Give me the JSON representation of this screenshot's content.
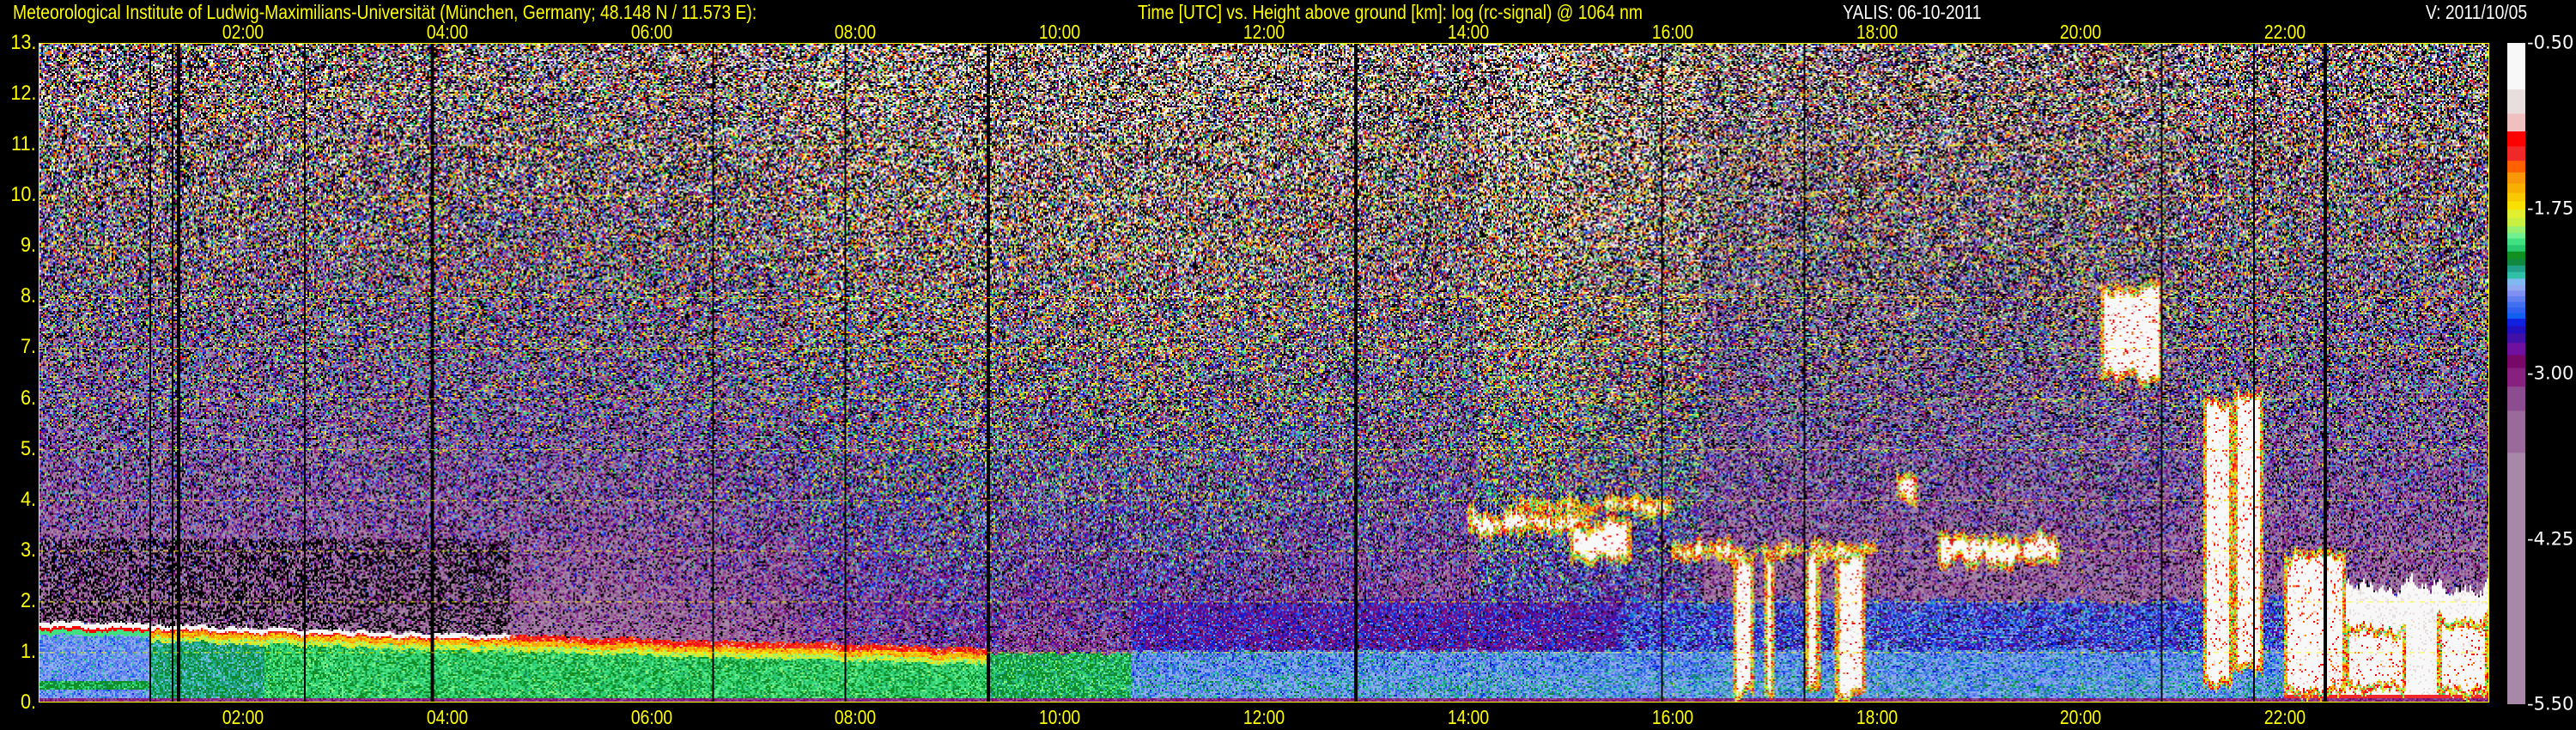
{
  "header": {
    "institute": "Meteorological Institute of Ludwig-Maximilians-Universität (München, Germany; 48.148 N / 11.573 E):",
    "description": "Time [UTC] vs. Height above ground [km]: log (rc-signal) @ 1064 nm",
    "instrument_date": "YALIS: 06-10-2011",
    "version": "V: 2011/10/05"
  },
  "chart_data": {
    "type": "heatmap",
    "title": "Time [UTC] vs. Height above ground [km]: log (rc-signal) @ 1064 nm",
    "xlabel": "Time [UTC]",
    "ylabel": "Height above ground [km]",
    "xlim_hours": [
      0,
      24
    ],
    "ylim_km": [
      0,
      13
    ],
    "x_ticks": [
      "02:00",
      "04:00",
      "06:00",
      "08:00",
      "10:00",
      "12:00",
      "14:00",
      "16:00",
      "18:00",
      "20:00",
      "22:00"
    ],
    "x_tick_hours": [
      2,
      4,
      6,
      8,
      10,
      12,
      14,
      16,
      18,
      20,
      22
    ],
    "y_ticks": [
      "0.",
      "1.",
      "2.",
      "3.",
      "4.",
      "5.",
      "6.",
      "7.",
      "8.",
      "9.",
      "10.",
      "11.",
      "12.",
      "13."
    ],
    "grid": true,
    "colorbar": {
      "range": [
        -5.5,
        -0.5
      ],
      "tick_labels": [
        "-0.50",
        "-1.75",
        "-3.00",
        "-4.25",
        "-5.50"
      ],
      "tick_values": [
        -0.5,
        -1.75,
        -3.0,
        -4.25,
        -5.5
      ],
      "bins": [
        {
          "from": -0.5,
          "to": -0.852,
          "color": "#f8f8f8"
        },
        {
          "from": -0.852,
          "to": -1.035,
          "color": "#e8dede"
        },
        {
          "from": -1.035,
          "to": -1.169,
          "color": "#f0c0c0"
        },
        {
          "from": -1.169,
          "to": -1.282,
          "color": "#ff0000"
        },
        {
          "from": -1.282,
          "to": -1.391,
          "color": "#f02828"
        },
        {
          "from": -1.391,
          "to": -1.479,
          "color": "#ff6000"
        },
        {
          "from": -1.479,
          "to": -1.563,
          "color": "#f89808"
        },
        {
          "from": -1.563,
          "to": -1.634,
          "color": "#f8b000"
        },
        {
          "from": -1.634,
          "to": -1.697,
          "color": "#f8c800"
        },
        {
          "from": -1.697,
          "to": -1.761,
          "color": "#f8e000"
        },
        {
          "from": -1.761,
          "to": -1.824,
          "color": "#e0f030"
        },
        {
          "from": -1.824,
          "to": -1.887,
          "color": "#c8f040"
        },
        {
          "from": -1.887,
          "to": -1.937,
          "color": "#98f070"
        },
        {
          "from": -1.937,
          "to": -1.979,
          "color": "#70f090"
        },
        {
          "from": -1.979,
          "to": -2.028,
          "color": "#40e080"
        },
        {
          "from": -2.028,
          "to": -2.077,
          "color": "#28c870"
        },
        {
          "from": -2.077,
          "to": -2.134,
          "color": "#109020"
        },
        {
          "from": -2.134,
          "to": -2.183,
          "color": "#108840"
        },
        {
          "from": -2.183,
          "to": -2.232,
          "color": "#20a088"
        },
        {
          "from": -2.232,
          "to": -2.282,
          "color": "#30c0a8"
        },
        {
          "from": -2.282,
          "to": -2.331,
          "color": "#80b8f0"
        },
        {
          "from": -2.331,
          "to": -2.373,
          "color": "#90a8f0"
        },
        {
          "from": -2.373,
          "to": -2.415,
          "color": "#8090f0"
        },
        {
          "from": -2.415,
          "to": -2.458,
          "color": "#6080f0"
        },
        {
          "from": -2.458,
          "to": -2.5,
          "color": "#4070f0"
        },
        {
          "from": -2.5,
          "to": -2.542,
          "color": "#3060f0"
        },
        {
          "from": -2.542,
          "to": -2.585,
          "color": "#1060f0"
        },
        {
          "from": -2.585,
          "to": -2.641,
          "color": "#1020e0"
        },
        {
          "from": -2.641,
          "to": -2.697,
          "color": "#2010c0"
        },
        {
          "from": -2.697,
          "to": -2.768,
          "color": "#4010a8"
        },
        {
          "from": -2.768,
          "to": -2.859,
          "color": "#7010a0"
        },
        {
          "from": -2.859,
          "to": -2.958,
          "color": "#780868"
        },
        {
          "from": -2.958,
          "to": -3.099,
          "color": "#882080"
        },
        {
          "from": -3.099,
          "to": -3.282,
          "color": "#8c4c90"
        },
        {
          "from": -3.282,
          "to": -3.599,
          "color": "#9a6a9a"
        },
        {
          "from": -3.599,
          "to": -5.5,
          "color": "#a888a8"
        }
      ]
    },
    "cloud_features_hours_km": [
      [
        14.0,
        15.2,
        3.3,
        3.75
      ],
      [
        14.5,
        16.0,
        3.7,
        4.0
      ],
      [
        15.0,
        15.6,
        2.7,
        3.6
      ],
      [
        16.0,
        16.6,
        2.8,
        3.2
      ],
      [
        16.5,
        18.0,
        2.8,
        3.1
      ],
      [
        16.6,
        16.8,
        0.1,
        3.0
      ],
      [
        16.9,
        17.0,
        0.1,
        3.0
      ],
      [
        17.3,
        17.45,
        0.1,
        3.0
      ],
      [
        17.6,
        17.9,
        0.05,
        3.0
      ],
      [
        18.2,
        18.4,
        4.0,
        4.5
      ],
      [
        18.6,
        19.8,
        2.7,
        3.3
      ],
      [
        20.2,
        20.8,
        6.3,
        8.3
      ],
      [
        21.2,
        21.5,
        0.3,
        6.0
      ],
      [
        21.5,
        21.8,
        0.6,
        6.2
      ],
      [
        22.0,
        22.6,
        0.1,
        3.0
      ],
      [
        22.6,
        23.2,
        0.2,
        1.5
      ],
      [
        23.5,
        24.0,
        0.1,
        1.7
      ]
    ],
    "data_gaps_hours": [
      1.08,
      1.3,
      1.36,
      2.6,
      3.85,
      6.6,
      7.9,
      9.3,
      12.9,
      15.9,
      17.3,
      20.8,
      21.7,
      22.4
    ]
  }
}
